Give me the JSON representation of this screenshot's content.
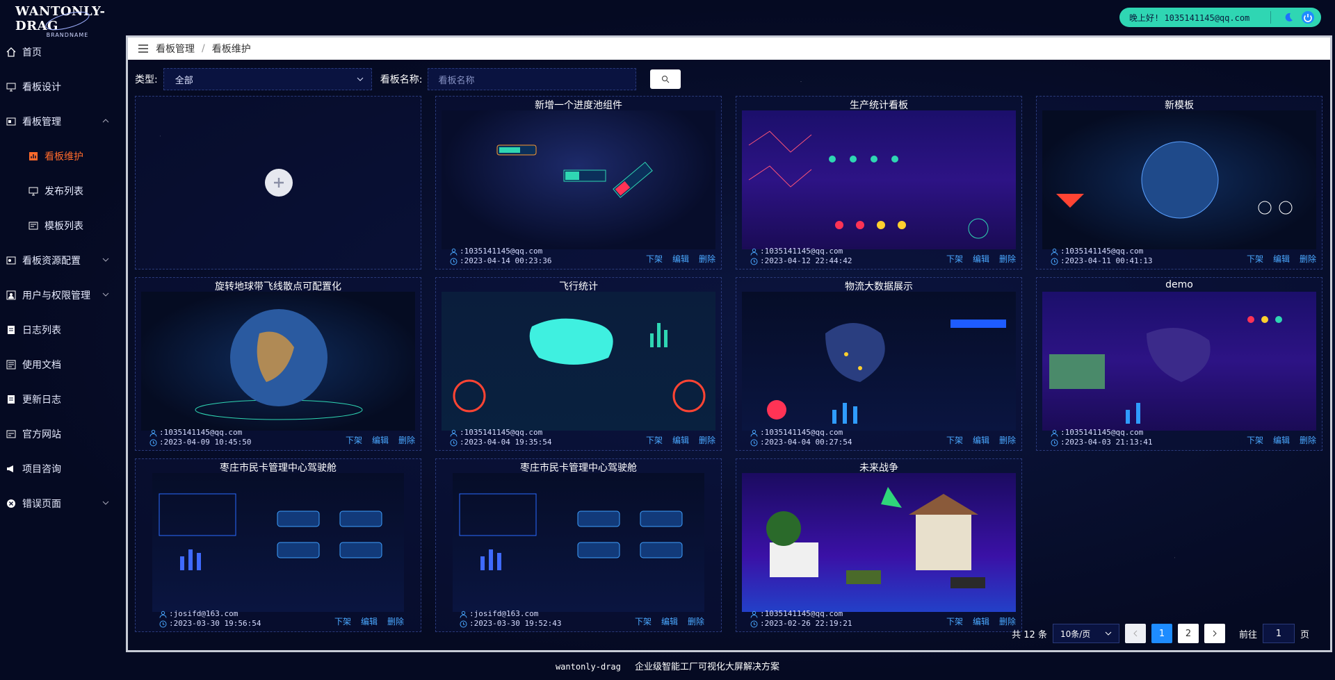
{
  "app": {
    "brand": "WANTONLY-DRAG",
    "brand_sub": "BRANDNAME"
  },
  "user": {
    "greeting": "晚上好! 1035141145@qq.com"
  },
  "sidebar": {
    "items": [
      {
        "label": "首页",
        "icon": "home-icon"
      },
      {
        "label": "看板设计",
        "icon": "monitor-icon"
      },
      {
        "label": "看板管理",
        "icon": "board-icon",
        "expanded": true
      },
      {
        "label": "看板维护",
        "icon": "chart-icon",
        "sub": true,
        "active": true
      },
      {
        "label": "发布列表",
        "icon": "monitor-icon",
        "sub": true
      },
      {
        "label": "模板列表",
        "icon": "template-icon",
        "sub": true
      },
      {
        "label": "看板资源配置",
        "icon": "resource-icon",
        "collapsed": true
      },
      {
        "label": "用户与权限管理",
        "icon": "user-icon",
        "collapsed": true
      },
      {
        "label": "日志列表",
        "icon": "log-icon"
      },
      {
        "label": "使用文档",
        "icon": "doc-icon"
      },
      {
        "label": "更新日志",
        "icon": "log-icon"
      },
      {
        "label": "官方网站",
        "icon": "site-icon"
      },
      {
        "label": "项目咨询",
        "icon": "megaphone-icon"
      },
      {
        "label": "错误页面",
        "icon": "error-icon",
        "collapsed": true
      }
    ]
  },
  "breadcrumb": {
    "parent": "看板管理",
    "current": "看板维护"
  },
  "filters": {
    "type_label": "类型:",
    "type_value": "全部",
    "name_label": "看板名称:",
    "name_placeholder": "看板名称"
  },
  "cards": [
    {
      "title": "新增一个进度池组件",
      "user": ":1035141145@qq.com",
      "time": ":2023-04-14 00:23:36",
      "thumb": "space"
    },
    {
      "title": "生产统计看板",
      "user": ":1035141145@qq.com",
      "time": ":2023-04-12 22:44:42",
      "thumb": "purple"
    },
    {
      "title": "新模板",
      "user": ":1035141145@qq.com",
      "time": ":2023-04-11 00:41:13",
      "thumb": "globe"
    },
    {
      "title": "旋转地球带飞线散点可配置化",
      "user": ":1035141145@qq.com",
      "time": ":2023-04-09 10:45:50",
      "thumb": "globe"
    },
    {
      "title": "飞行统计",
      "user": ":1035141145@qq.com",
      "time": ":2023-04-04 19:35:54",
      "thumb": "teal"
    },
    {
      "title": "物流大数据展示",
      "user": ":1035141145@qq.com",
      "time": ":2023-04-04 00:27:54",
      "thumb": "dark"
    },
    {
      "title": "demo",
      "user": ":1035141145@qq.com",
      "time": ":2023-04-03 21:13:41",
      "thumb": "purple"
    },
    {
      "title": "枣庄市民卡管理中心驾驶舱",
      "user": ":josifd@163.com",
      "time": ":2023-03-30 19:56:54",
      "thumb": "dark"
    },
    {
      "title": "枣庄市民卡管理中心驾驶舱",
      "user": ":josifd@163.com",
      "time": ":2023-03-30 19:52:43",
      "thumb": "dark"
    },
    {
      "title": "未来战争",
      "user": ":1035141145@qq.com",
      "time": ":2023-02-26 22:19:21",
      "thumb": "war"
    }
  ],
  "actions": {
    "unpublish": "下架",
    "edit": "编辑",
    "delete": "删除"
  },
  "pagination": {
    "total_text": "共 12 条",
    "page_size": "10条/页",
    "pages": [
      "1",
      "2"
    ],
    "current": "1",
    "goto_prefix": "前往",
    "goto_value": "1",
    "goto_suffix": "页"
  },
  "footer": {
    "brand": "wantonly-drag",
    "slogan": "企业级智能工厂可视化大屏解决方案"
  },
  "colors": {
    "accent": "#1e8cff",
    "active_nav": "#ff6a2b",
    "pill": "#2fd6b3",
    "link": "#4aa8ff"
  }
}
